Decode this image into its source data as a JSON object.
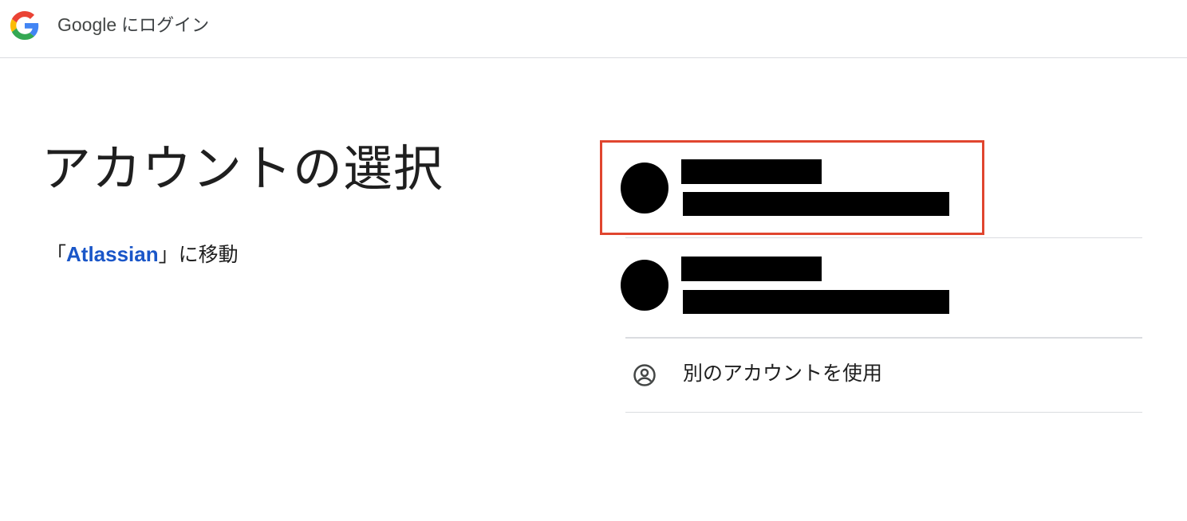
{
  "header": {
    "brand": "Google",
    "action": "にログイン",
    "logo_icon": "google-g-logo",
    "colors": {
      "blue": "#4285F4",
      "red": "#EA4335",
      "yellow": "#FBBC05",
      "green": "#34A853"
    }
  },
  "main": {
    "title": "アカウントの選択",
    "subtitle": {
      "prefix": "「",
      "link": "Atlassian",
      "suffix": "」に移動",
      "link_color": "#1a56c8"
    }
  },
  "accounts": [
    {
      "avatar_icon": "redacted-avatar",
      "name_redacted": true,
      "email_redacted": true,
      "highlighted": true
    },
    {
      "avatar_icon": "redacted-avatar",
      "name_redacted": true,
      "email_redacted": true,
      "highlighted": false
    }
  ],
  "other_account": {
    "label": "別のアカウントを使用",
    "icon": "account-circle-icon"
  },
  "highlight_color": "#e0452f"
}
